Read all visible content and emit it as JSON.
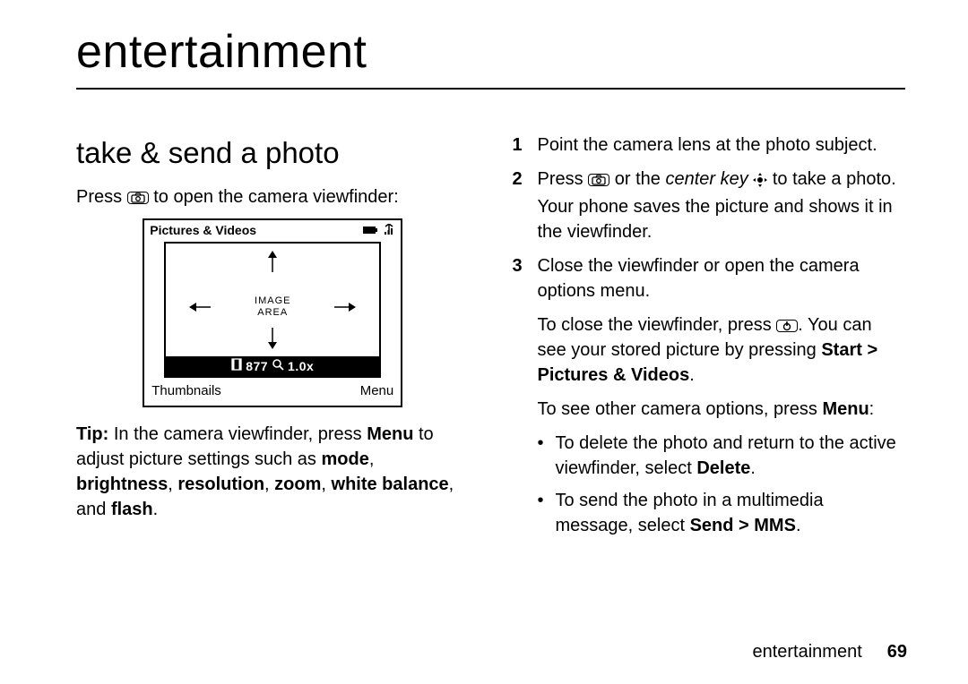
{
  "chapter_title": "entertainment",
  "left": {
    "section_heading": "take & send a photo",
    "intro_before": "Press ",
    "intro_after": " to open the camera viewfinder:",
    "tip": {
      "lead": "Tip:",
      "t1": " In the camera viewfinder, press ",
      "menu": "Menu",
      "t2": " to adjust picture settings such as ",
      "mode": "mode",
      "comma1": ", ",
      "brightness": "brightness",
      "comma2": ", ",
      "resolution": "resolution",
      "comma3": ", ",
      "zoom": "zoom",
      "comma4": ", ",
      "white_balance": "white balance",
      "and": ", and ",
      "flash": "flash",
      "period": "."
    }
  },
  "viewfinder": {
    "title": "Pictures & Videos",
    "center_line1": "IMAGE",
    "center_line2": "AREA",
    "status_count": "877",
    "status_zoom": "1.0x",
    "soft_left": "Thumbnails",
    "soft_right": "Menu"
  },
  "right": {
    "step1": {
      "num": "1",
      "text": "Point the camera lens at the photo subject."
    },
    "step2": {
      "num": "2",
      "t1": "Press ",
      "t2": " or the ",
      "center_key": "center key",
      "t3": " to take a photo. Your phone saves the picture and shows it in the viewfinder."
    },
    "step3": {
      "num": "3",
      "text": "Close the viewfinder or open the camera options menu."
    },
    "close": {
      "t1": "To close the viewfinder, press ",
      "t2": ". You can see your stored picture by pressing ",
      "path": "Start > Pictures & Videos",
      "t3": "."
    },
    "other": {
      "t1": "To see other camera options, press ",
      "menu": "Menu",
      "t2": ":"
    },
    "bullet1": {
      "t1": "To delete the photo and return to the active viewfinder, select ",
      "delete": "Delete",
      "t2": "."
    },
    "bullet2": {
      "t1": "To send the photo in a multimedia message, select ",
      "send": "Send > MMS",
      "t2": "."
    }
  },
  "footer": {
    "label": "entertainment",
    "page": "69"
  }
}
